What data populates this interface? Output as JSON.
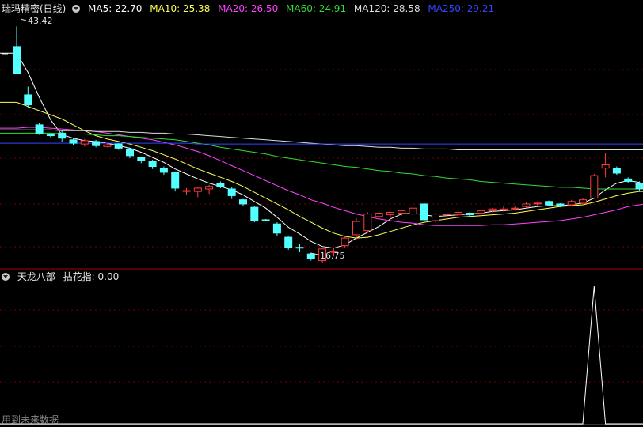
{
  "main_panel": {
    "title": "瑞玛精密(日线)",
    "ma": [
      {
        "label": "MA5: 22.70",
        "color": "#ffffff"
      },
      {
        "label": "MA10: 25.38",
        "color": "#ffff55"
      },
      {
        "label": "MA20: 26.50",
        "color": "#ff44ff"
      },
      {
        "label": "MA60: 24.91",
        "color": "#33dd33"
      },
      {
        "label": "MA120: 28.58",
        "color": "#dddddd"
      },
      {
        "label": "MA250: 29.21",
        "color": "#3344ff"
      }
    ],
    "high_label": "43.42",
    "low_label": "16.75"
  },
  "sub_panel": {
    "title": "天龙八部",
    "indicator": "拈花指: 0.00",
    "footer": "用到未来数据"
  },
  "colors": {
    "up": "#ff3c3c",
    "down": "#54ffff",
    "grid": "#7a0000",
    "divider": "#b00000"
  },
  "chart_data": {
    "type": "candlestick",
    "candles": [
      {
        "o": 41.0,
        "h": 43.42,
        "l": 37.8,
        "c": 37.8,
        "dir": "down"
      },
      {
        "o": 35.2,
        "h": 36.2,
        "l": 33.6,
        "c": 34.0,
        "dir": "down"
      },
      {
        "o": 31.6,
        "h": 31.8,
        "l": 30.4,
        "c": 30.6,
        "dir": "down"
      },
      {
        "o": 30.4,
        "h": 30.4,
        "l": 30.1,
        "c": 30.3,
        "dir": "down"
      },
      {
        "o": 30.6,
        "h": 31.0,
        "l": 29.6,
        "c": 30.0,
        "dir": "down"
      },
      {
        "o": 29.8,
        "h": 30.0,
        "l": 29.2,
        "c": 29.4,
        "dir": "down"
      },
      {
        "o": 29.3,
        "h": 29.9,
        "l": 29.0,
        "c": 29.7,
        "dir": "up"
      },
      {
        "o": 29.6,
        "h": 29.8,
        "l": 28.9,
        "c": 29.1,
        "dir": "down"
      },
      {
        "o": 29.2,
        "h": 29.4,
        "l": 28.9,
        "c": 29.0,
        "dir": "up"
      },
      {
        "o": 29.3,
        "h": 29.4,
        "l": 28.6,
        "c": 28.8,
        "dir": "down"
      },
      {
        "o": 28.7,
        "h": 28.8,
        "l": 27.6,
        "c": 27.9,
        "dir": "down"
      },
      {
        "o": 27.7,
        "h": 27.8,
        "l": 27.0,
        "c": 27.3,
        "dir": "down"
      },
      {
        "o": 27.2,
        "h": 27.4,
        "l": 26.3,
        "c": 26.6,
        "dir": "down"
      },
      {
        "o": 26.4,
        "h": 26.6,
        "l": 25.6,
        "c": 25.9,
        "dir": "down"
      },
      {
        "o": 25.9,
        "h": 26.0,
        "l": 23.6,
        "c": 24.0,
        "dir": "down"
      },
      {
        "o": 23.7,
        "h": 24.0,
        "l": 23.2,
        "c": 23.7,
        "dir": "up"
      },
      {
        "o": 23.6,
        "h": 24.1,
        "l": 22.9,
        "c": 24.0,
        "dir": "up"
      },
      {
        "o": 23.9,
        "h": 24.4,
        "l": 23.3,
        "c": 24.2,
        "dir": "up"
      },
      {
        "o": 24.6,
        "h": 24.8,
        "l": 24.0,
        "c": 24.2,
        "dir": "down"
      },
      {
        "o": 23.9,
        "h": 24.1,
        "l": 22.7,
        "c": 23.1,
        "dir": "down"
      },
      {
        "o": 22.6,
        "h": 22.7,
        "l": 21.9,
        "c": 22.1,
        "dir": "down"
      },
      {
        "o": 21.7,
        "h": 21.8,
        "l": 19.9,
        "c": 20.1,
        "dir": "down"
      },
      {
        "o": 20.2,
        "h": 20.3,
        "l": 20.1,
        "c": 20.2,
        "dir": "down"
      },
      {
        "o": 19.7,
        "h": 19.9,
        "l": 18.3,
        "c": 18.6,
        "dir": "down"
      },
      {
        "o": 18.1,
        "h": 18.2,
        "l": 16.6,
        "c": 16.9,
        "dir": "down"
      },
      {
        "o": 16.9,
        "h": 17.3,
        "l": 16.3,
        "c": 16.9,
        "dir": "down"
      },
      {
        "o": 16.1,
        "h": 16.2,
        "l": 15.3,
        "c": 15.5,
        "dir": "down"
      },
      {
        "o": 15.3,
        "h": 16.8,
        "l": 15.0,
        "c": 16.7,
        "dir": "up"
      },
      {
        "o": 16.3,
        "h": 16.75,
        "l": 15.8,
        "c": 16.4,
        "dir": "up"
      },
      {
        "o": 17.1,
        "h": 18.2,
        "l": 16.8,
        "c": 18.0,
        "dir": "up"
      },
      {
        "o": 18.4,
        "h": 20.4,
        "l": 17.8,
        "c": 20.0,
        "dir": "up"
      },
      {
        "o": 18.9,
        "h": 21.1,
        "l": 18.7,
        "c": 20.9,
        "dir": "up"
      },
      {
        "o": 20.6,
        "h": 21.3,
        "l": 20.2,
        "c": 21.0,
        "dir": "up"
      },
      {
        "o": 20.8,
        "h": 21.2,
        "l": 20.3,
        "c": 21.1,
        "dir": "up"
      },
      {
        "o": 21.0,
        "h": 21.4,
        "l": 20.7,
        "c": 21.3,
        "dir": "up"
      },
      {
        "o": 20.9,
        "h": 21.9,
        "l": 20.6,
        "c": 21.6,
        "dir": "up"
      },
      {
        "o": 22.1,
        "h": 22.2,
        "l": 20.1,
        "c": 20.2,
        "dir": "down"
      },
      {
        "o": 20.1,
        "h": 21.0,
        "l": 19.9,
        "c": 20.9,
        "dir": "up"
      },
      {
        "o": 20.9,
        "h": 21.0,
        "l": 20.7,
        "c": 20.9,
        "dir": "up"
      },
      {
        "o": 20.8,
        "h": 21.2,
        "l": 20.8,
        "c": 21.1,
        "dir": "up"
      },
      {
        "o": 21.0,
        "h": 21.1,
        "l": 20.6,
        "c": 20.8,
        "dir": "down"
      },
      {
        "o": 21.0,
        "h": 21.4,
        "l": 20.8,
        "c": 21.3,
        "dir": "up"
      },
      {
        "o": 21.3,
        "h": 21.6,
        "l": 21.1,
        "c": 21.5,
        "dir": "up"
      },
      {
        "o": 21.4,
        "h": 21.8,
        "l": 21.2,
        "c": 21.5,
        "dir": "up"
      },
      {
        "o": 21.6,
        "h": 21.9,
        "l": 21.3,
        "c": 21.5,
        "dir": "up"
      },
      {
        "o": 21.8,
        "h": 22.3,
        "l": 21.6,
        "c": 22.1,
        "dir": "up"
      },
      {
        "o": 22.2,
        "h": 22.4,
        "l": 21.9,
        "c": 22.2,
        "dir": "up"
      },
      {
        "o": 22.4,
        "h": 22.5,
        "l": 21.9,
        "c": 22.0,
        "dir": "down"
      },
      {
        "o": 22.1,
        "h": 22.2,
        "l": 21.7,
        "c": 21.9,
        "dir": "down"
      },
      {
        "o": 22.0,
        "h": 22.6,
        "l": 21.9,
        "c": 22.4,
        "dir": "up"
      },
      {
        "o": 22.2,
        "h": 22.8,
        "l": 22.1,
        "c": 22.6,
        "dir": "up"
      },
      {
        "o": 22.8,
        "h": 25.7,
        "l": 22.7,
        "c": 25.5,
        "dir": "up"
      },
      {
        "o": 26.4,
        "h": 28.2,
        "l": 25.3,
        "c": 26.8,
        "dir": "up"
      },
      {
        "o": 26.4,
        "h": 26.6,
        "l": 25.6,
        "c": 25.8,
        "dir": "down"
      },
      {
        "o": 25.1,
        "h": 25.3,
        "l": 24.6,
        "c": 24.8,
        "dir": "down"
      },
      {
        "o": 24.6,
        "h": 24.8,
        "l": 23.6,
        "c": 23.9,
        "dir": "down"
      },
      {
        "o": 24.1,
        "h": 24.6,
        "l": 23.7,
        "c": 24.2,
        "dir": "up"
      }
    ],
    "ma_lines": {
      "ma5": [
        40.2,
        37.9,
        34.9,
        32.2,
        30.4,
        30.0,
        29.7,
        29.6,
        29.4,
        29.1,
        28.8,
        28.3,
        27.7,
        27.1,
        26.3,
        25.7,
        25.1,
        24.6,
        24.2,
        23.8,
        23.2,
        22.4,
        21.6,
        20.5,
        19.3,
        18.5,
        17.6,
        17.0,
        16.8,
        17.2,
        18.0,
        18.7,
        19.4,
        20.3,
        20.9,
        21.0,
        20.8,
        20.6,
        20.7,
        20.8,
        20.9,
        21.0,
        21.2,
        21.3,
        21.4,
        21.6,
        21.8,
        21.9,
        21.9,
        22.0,
        22.2,
        22.8,
        23.8,
        24.6,
        24.9,
        24.7,
        23.6
      ],
      "ma10": [
        34.3,
        33.8,
        33.3,
        32.8,
        32.3,
        31.6,
        30.9,
        30.3,
        29.9,
        29.6,
        29.3,
        28.9,
        28.5,
        28.0,
        27.5,
        26.9,
        26.3,
        25.8,
        25.3,
        24.8,
        24.2,
        23.5,
        22.8,
        22.1,
        21.4,
        20.6,
        19.9,
        19.2,
        18.6,
        18.2,
        18.0,
        18.1,
        18.4,
        18.8,
        19.2,
        19.6,
        19.9,
        20.1,
        20.3,
        20.5,
        20.6,
        20.7,
        20.8,
        20.9,
        21.0,
        21.2,
        21.4,
        21.6,
        21.8,
        21.9,
        22.0,
        22.3,
        22.7,
        23.1,
        23.4,
        23.6,
        23.6
      ],
      "ma20": [
        31.2,
        31.3,
        31.3,
        31.2,
        31.1,
        31.0,
        30.9,
        30.8,
        30.6,
        30.4,
        30.2,
        30.0,
        29.8,
        29.5,
        29.2,
        28.8,
        28.4,
        27.9,
        27.3,
        26.7,
        26.1,
        25.5,
        24.9,
        24.3,
        23.7,
        23.2,
        22.6,
        22.2,
        21.7,
        21.3,
        20.9,
        20.6,
        20.3,
        20.1,
        19.9,
        19.8,
        19.6,
        19.5,
        19.5,
        19.5,
        19.5,
        19.5,
        19.6,
        19.6,
        19.7,
        19.8,
        19.9,
        20.0,
        20.1,
        20.3,
        20.5,
        20.8,
        21.1,
        21.4,
        21.8,
        22.0,
        22.2
      ],
      "ma60": [
        30.6,
        30.6,
        30.6,
        30.6,
        30.5,
        30.5,
        30.5,
        30.4,
        30.3,
        30.3,
        30.2,
        30.1,
        30.0,
        29.9,
        29.8,
        29.6,
        29.4,
        29.2,
        28.9,
        28.7,
        28.5,
        28.3,
        28.1,
        27.8,
        27.6,
        27.4,
        27.2,
        27.0,
        26.8,
        26.6,
        26.5,
        26.3,
        26.1,
        26.0,
        25.8,
        25.7,
        25.5,
        25.4,
        25.2,
        25.1,
        25.0,
        24.8,
        24.7,
        24.6,
        24.5,
        24.4,
        24.3,
        24.2,
        24.1,
        24.1,
        24.0,
        23.9,
        23.9,
        23.9,
        23.9,
        23.9,
        23.9
      ],
      "ma120": [
        31.0,
        31.0,
        31.0,
        31.0,
        30.9,
        30.9,
        30.9,
        30.8,
        30.8,
        30.8,
        30.7,
        30.7,
        30.6,
        30.6,
        30.5,
        30.5,
        30.4,
        30.3,
        30.2,
        30.1,
        30.0,
        29.9,
        29.8,
        29.7,
        29.6,
        29.5,
        29.4,
        29.3,
        29.2,
        29.1,
        29.1,
        29.0,
        28.9,
        28.9,
        28.8,
        28.8,
        28.7,
        28.7,
        28.7,
        28.6,
        28.6,
        28.6,
        28.6,
        28.6,
        28.6,
        28.6,
        28.6,
        28.6,
        28.6,
        28.6,
        28.6,
        28.6,
        28.6,
        28.6,
        28.6,
        28.6,
        28.6
      ],
      "ma250": [
        29.4,
        29.4,
        29.4,
        29.4,
        29.4,
        29.4,
        29.4,
        29.4,
        29.4,
        29.4,
        29.4,
        29.4,
        29.4,
        29.4,
        29.4,
        29.4,
        29.3,
        29.3,
        29.3,
        29.3,
        29.3,
        29.3,
        29.3,
        29.3,
        29.3,
        29.3,
        29.3,
        29.3,
        29.3,
        29.3,
        29.3,
        29.3,
        29.3,
        29.3,
        29.3,
        29.3,
        29.3,
        29.3,
        29.3,
        29.3,
        29.3,
        29.3,
        29.3,
        29.3,
        29.3,
        29.3,
        29.3,
        29.3,
        29.3,
        29.3,
        29.3,
        29.3,
        29.3,
        29.3,
        29.3,
        29.3,
        29.3
      ]
    },
    "indicator_values": [
      0,
      0,
      0,
      0,
      0,
      0,
      0,
      0,
      0,
      0,
      0,
      0,
      0,
      0,
      0,
      0,
      0,
      0,
      0,
      0,
      0,
      0,
      0,
      0,
      0,
      0,
      0,
      0,
      0,
      0,
      0,
      0,
      0,
      0,
      0,
      0,
      0,
      0,
      0,
      0,
      0,
      0,
      0,
      0,
      0,
      0,
      0,
      0,
      0,
      0,
      0,
      1,
      0,
      0,
      0,
      0,
      0
    ],
    "ylim": [
      14.5,
      44.5
    ]
  }
}
